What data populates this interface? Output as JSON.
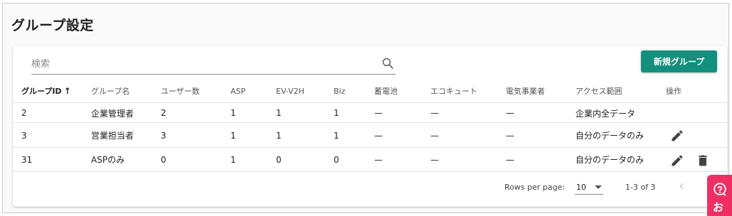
{
  "page": {
    "title": "グループ設定"
  },
  "search": {
    "placeholder": "検索",
    "value": ""
  },
  "toolbar": {
    "new_group_label": "新規グループ"
  },
  "table": {
    "columns": [
      "グループID",
      "グループ名",
      "ユーザー数",
      "ASP",
      "EV-V2H",
      "Biz",
      "蓄電池",
      "エコキュート",
      "電気事業者",
      "アクセス範囲",
      "操作"
    ],
    "sort": {
      "column": "グループID",
      "direction": "asc",
      "indicator": "↑"
    },
    "rows": [
      {
        "cells": [
          "2",
          "企業管理者",
          "2",
          "1",
          "1",
          "1",
          "—",
          "—",
          "—",
          "企業内全データ"
        ],
        "actions": []
      },
      {
        "cells": [
          "3",
          "営業担当者",
          "3",
          "1",
          "1",
          "1",
          "—",
          "—",
          "—",
          "自分のデータのみ"
        ],
        "actions": [
          "edit-icon"
        ]
      },
      {
        "cells": [
          "31",
          "ASPのみ",
          "0",
          "1",
          "0",
          "0",
          "—",
          "—",
          "—",
          "自分のデータのみ"
        ],
        "actions": [
          "edit-icon",
          "delete-icon"
        ]
      }
    ]
  },
  "pagination": {
    "rows_per_page_label": "Rows per page:",
    "rows_per_page_value": "10",
    "range_text": "1-3 of 3"
  },
  "help_widget": {
    "label": "お",
    "icon": "help-question-icon",
    "color": "#ef2f64"
  },
  "colors": {
    "primary": "#138f7d",
    "help": "#ef2f64"
  }
}
